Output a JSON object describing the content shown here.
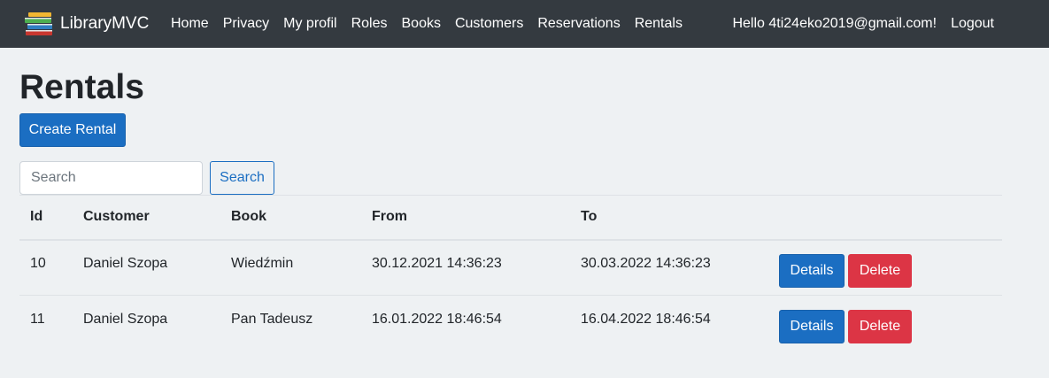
{
  "navbar": {
    "brand": "LibraryMVC",
    "links": [
      "Home",
      "Privacy",
      "My profil",
      "Roles",
      "Books",
      "Customers",
      "Reservations",
      "Rentals"
    ],
    "greeting": "Hello 4ti24eko2019@gmail.com!",
    "logout": "Logout"
  },
  "page": {
    "title": "Rentals",
    "create_label": "Create Rental"
  },
  "search": {
    "placeholder": "Search",
    "value": "",
    "button_label": "Search"
  },
  "table": {
    "headers": [
      "Id",
      "Customer",
      "Book",
      "From",
      "To"
    ],
    "rows": [
      {
        "id": "10",
        "customer": "Daniel Szopa",
        "book": "Wiedźmin",
        "from": "30.12.2021 14:36:23",
        "to": "30.03.2022 14:36:23",
        "details": "Details",
        "delete": "Delete"
      },
      {
        "id": "11",
        "customer": "Daniel Szopa",
        "book": "Pan Tadeusz",
        "from": "16.01.2022 18:46:54",
        "to": "16.04.2022 18:46:54",
        "details": "Details",
        "delete": "Delete"
      }
    ]
  },
  "colors": {
    "navbar_bg": "#343a40",
    "primary": "#1b6ec2",
    "danger": "#dc3545",
    "page_bg": "#eef1f3"
  }
}
